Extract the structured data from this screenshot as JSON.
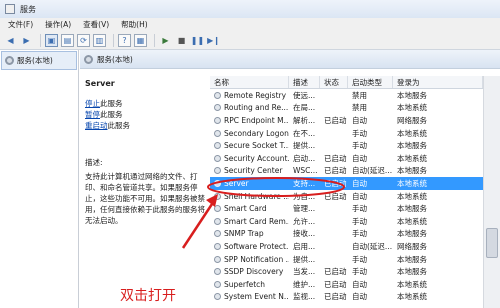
{
  "window": {
    "title": "服务"
  },
  "menu": [
    "文件(F)",
    "操作(A)",
    "查看(V)",
    "帮助(H)"
  ],
  "tree": {
    "item_label": "服务(本地)"
  },
  "pane": {
    "header": "服务(本地)"
  },
  "details": {
    "service_name": "Server",
    "link_stop": "停止",
    "link_stop_suffix": "此服务",
    "link_pause": "暂停",
    "link_pause_suffix": "此服务",
    "link_restart": "重启动",
    "link_restart_suffix": "此服务",
    "desc_label": "描述:",
    "desc_lines": [
      "支持此计算机通过网络的文件、打",
      "印、和命名管道共享。如果服务停",
      "止，这些功能不可用。如果服务被禁",
      "用，任何直接依赖于此服务的服务将",
      "无法启动。"
    ]
  },
  "columns": {
    "name": "名称",
    "desc": "描述",
    "state": "状态",
    "startup": "启动类型",
    "logon": "登录为"
  },
  "rows": [
    {
      "name": "Remote Registry",
      "desc": "使远...",
      "state": "",
      "startup": "禁用",
      "logon": "本地服务"
    },
    {
      "name": "Routing and Re...",
      "desc": "在局...",
      "state": "",
      "startup": "禁用",
      "logon": "本地系统"
    },
    {
      "name": "RPC Endpoint M...",
      "desc": "解析...",
      "state": "已启动",
      "startup": "自动",
      "logon": "网络服务"
    },
    {
      "name": "Secondary Logon",
      "desc": "在不...",
      "state": "",
      "startup": "手动",
      "logon": "本地系统"
    },
    {
      "name": "Secure Socket T...",
      "desc": "提供...",
      "state": "",
      "startup": "手动",
      "logon": "本地服务"
    },
    {
      "name": "Security Account...",
      "desc": "启动...",
      "state": "已启动",
      "startup": "自动",
      "logon": "本地系统"
    },
    {
      "name": "Security Center",
      "desc": "WSC...",
      "state": "已启动",
      "startup": "自动(延迟...",
      "logon": "本地服务"
    },
    {
      "name": "Server",
      "desc": "支持...",
      "state": "已启动",
      "startup": "自动",
      "logon": "本地系统"
    },
    {
      "name": "Shell Hardware ...",
      "desc": "为自...",
      "state": "已启动",
      "startup": "自动",
      "logon": "本地系统"
    },
    {
      "name": "Smart Card",
      "desc": "管理...",
      "state": "",
      "startup": "手动",
      "logon": "本地服务"
    },
    {
      "name": "Smart Card Rem...",
      "desc": "允许...",
      "state": "",
      "startup": "手动",
      "logon": "本地系统"
    },
    {
      "name": "SNMP Trap",
      "desc": "接收...",
      "state": "",
      "startup": "手动",
      "logon": "本地服务"
    },
    {
      "name": "Software Protect...",
      "desc": "启用...",
      "state": "",
      "startup": "自动(延迟...",
      "logon": "网络服务"
    },
    {
      "name": "SPP Notification ...",
      "desc": "提供...",
      "state": "",
      "startup": "手动",
      "logon": "本地服务"
    },
    {
      "name": "SSDP Discovery",
      "desc": "当发...",
      "state": "已启动",
      "startup": "手动",
      "logon": "本地服务"
    },
    {
      "name": "Superfetch",
      "desc": "维护...",
      "state": "已启动",
      "startup": "自动",
      "logon": "本地系统"
    },
    {
      "name": "System Event N...",
      "desc": "监视...",
      "state": "已启动",
      "startup": "自动",
      "logon": "本地系统"
    }
  ],
  "selected_row": "Server",
  "annotation": {
    "text": "双击打开",
    "color": "#d81e1e"
  },
  "colors": {
    "selection": "#3399ff",
    "link": "#0645ad"
  }
}
